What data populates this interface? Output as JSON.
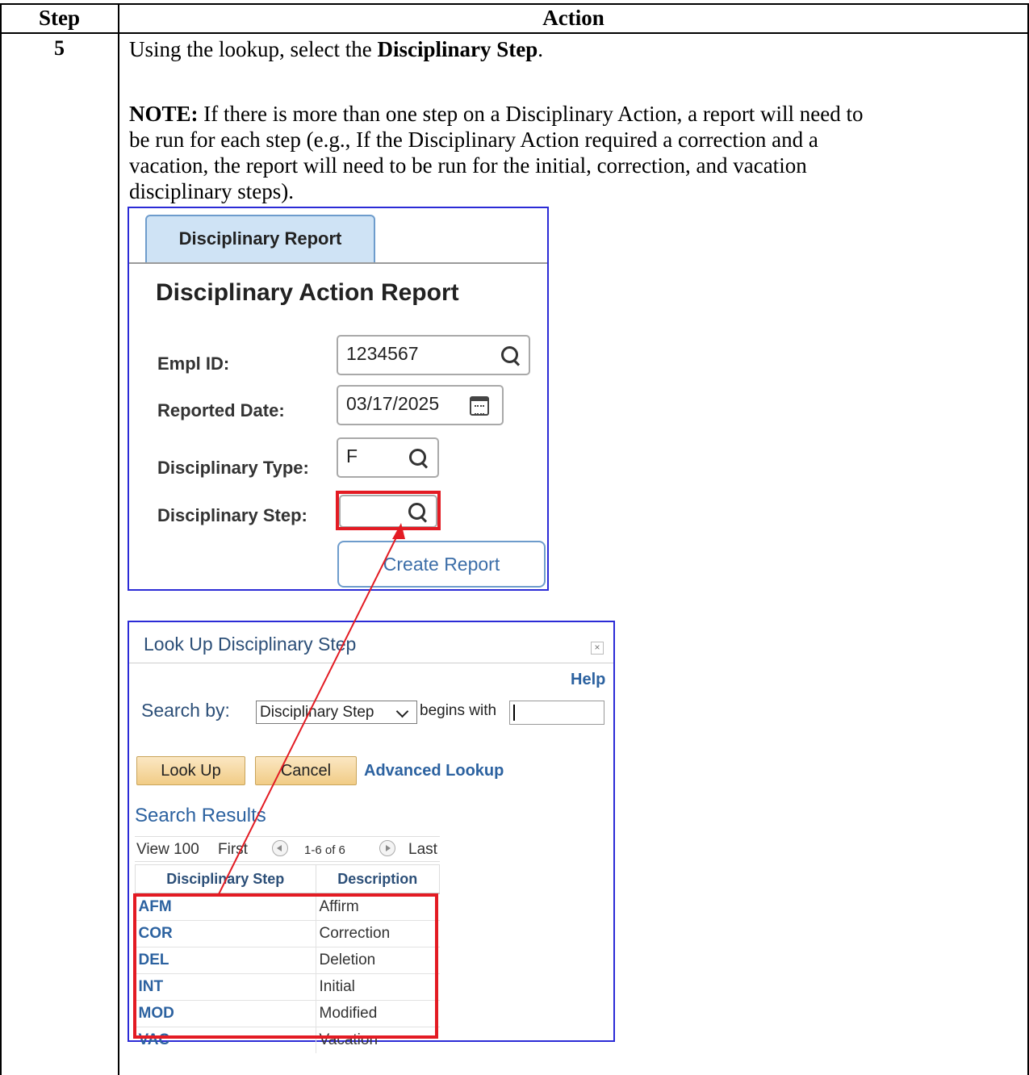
{
  "table": {
    "header_step": "Step",
    "header_action": "Action",
    "step_number": "5"
  },
  "instruction": {
    "line1_prefix": "Using the lookup, select the ",
    "line1_bold": "Disciplinary Step",
    "line1_suffix": ".",
    "note_label": "NOTE:",
    "note_line1": " If there is more than one step on a Disciplinary Action, a report will need to",
    "note_line2": "be run for each step (e.g., If the Disciplinary Action required a correction and a",
    "note_line3": "vacation, the report will need to be run for the initial, correction, and vacation",
    "note_line4": "disciplinary steps)."
  },
  "report": {
    "tab_label": "Disciplinary Report",
    "page_title": "Disciplinary Action Report",
    "empl_id_label": "Empl ID:",
    "empl_id_value": "1234567",
    "reported_date_label": "Reported Date:",
    "reported_date_value": "03/17/2025",
    "disc_type_label": "Disciplinary Type:",
    "disc_type_value": "F",
    "disc_step_label": "Disciplinary Step:",
    "disc_step_value": "",
    "create_button": "Create Report"
  },
  "lookup": {
    "title": "Look Up Disciplinary Step",
    "close_glyph": "×",
    "help": "Help",
    "search_by_label": "Search by:",
    "search_by_value": "Disciplinary Step",
    "operator": "begins with",
    "search_input_value": "",
    "lookup_button": "Look Up",
    "cancel_button": "Cancel",
    "advanced_link": "Advanced Lookup",
    "results_title": "Search Results",
    "nav": {
      "view": "View 100",
      "first": "First",
      "range": "1-6 of 6",
      "last": "Last"
    },
    "columns": [
      "Disciplinary Step",
      "Description"
    ],
    "rows": [
      {
        "code": "AFM",
        "desc": "Affirm"
      },
      {
        "code": "COR",
        "desc": "Correction"
      },
      {
        "code": "DEL",
        "desc": "Deletion"
      },
      {
        "code": "INT",
        "desc": "Initial"
      },
      {
        "code": "MOD",
        "desc": "Modified"
      },
      {
        "code": "VAC",
        "desc": "Vacation"
      }
    ]
  },
  "colors": {
    "highlight_red": "#e31b23",
    "frame_blue": "#2b2bd6",
    "tab_fill": "#cfe3f5",
    "link_blue": "#2c62a0"
  },
  "icons": [
    "search-icon",
    "calendar-icon",
    "close-icon",
    "chevron-down-icon",
    "previous-icon",
    "next-icon"
  ]
}
